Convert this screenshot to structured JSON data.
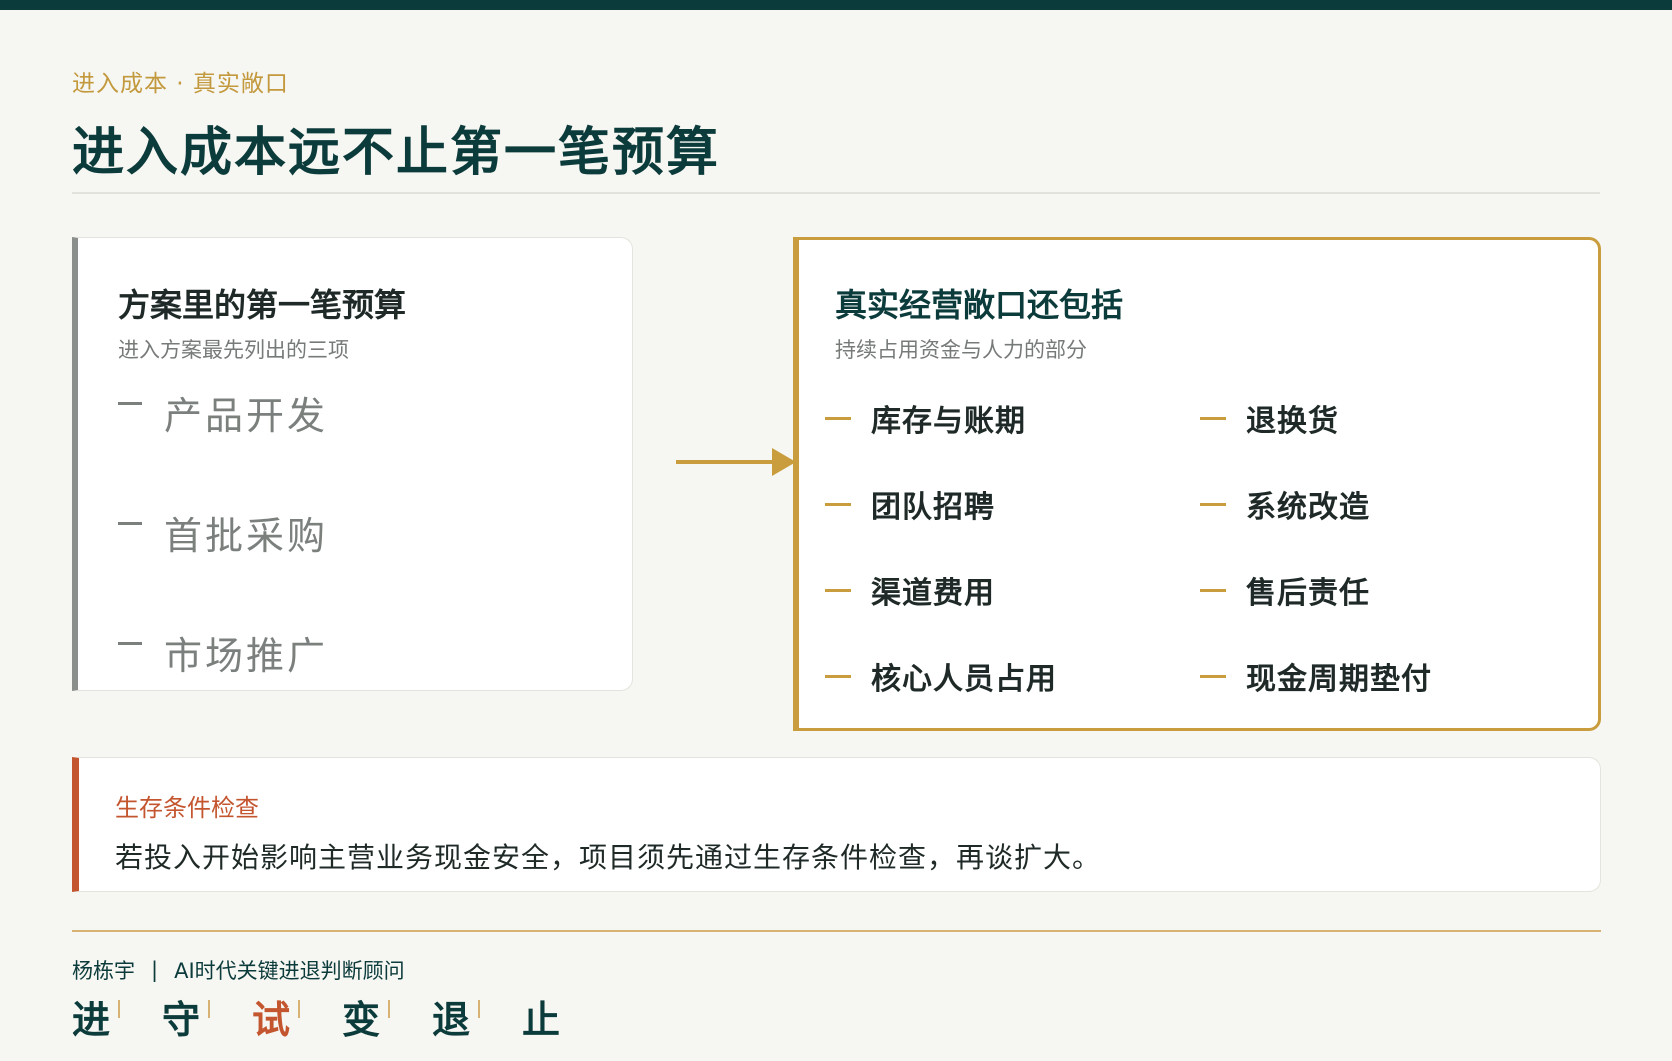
{
  "eyebrow": "进入成本 · 真实敞口",
  "title": "进入成本远不止第一笔预算",
  "left_card": {
    "title": "方案里的第一笔预算",
    "subtitle": "进入方案最先列出的三项",
    "items": [
      "产品开发",
      "首批采购",
      "市场推广"
    ]
  },
  "right_card": {
    "title": "真实经营敞口还包括",
    "subtitle": "持续占用资金与人力的部分",
    "items": [
      "库存与账期",
      "退换货",
      "团队招聘",
      "系统改造",
      "渠道费用",
      "售后责任",
      "核心人员占用",
      "现金周期垫付"
    ]
  },
  "callout": {
    "title": "生存条件检查",
    "text": "若投入开始影响主营业务现金安全，项目须先通过生存条件检查，再谈扩大。"
  },
  "footer": {
    "author": "杨栋宇",
    "separator": "|",
    "role": "AI时代关键进退判断顾问",
    "motto": [
      "进",
      "守",
      "试",
      "变",
      "退",
      "止"
    ],
    "motto_active": "试"
  },
  "colors": {
    "primary": "#0c3b3b",
    "accent_gold": "#c99d3d",
    "accent_red": "#c4562f",
    "muted": "#7b807d"
  }
}
